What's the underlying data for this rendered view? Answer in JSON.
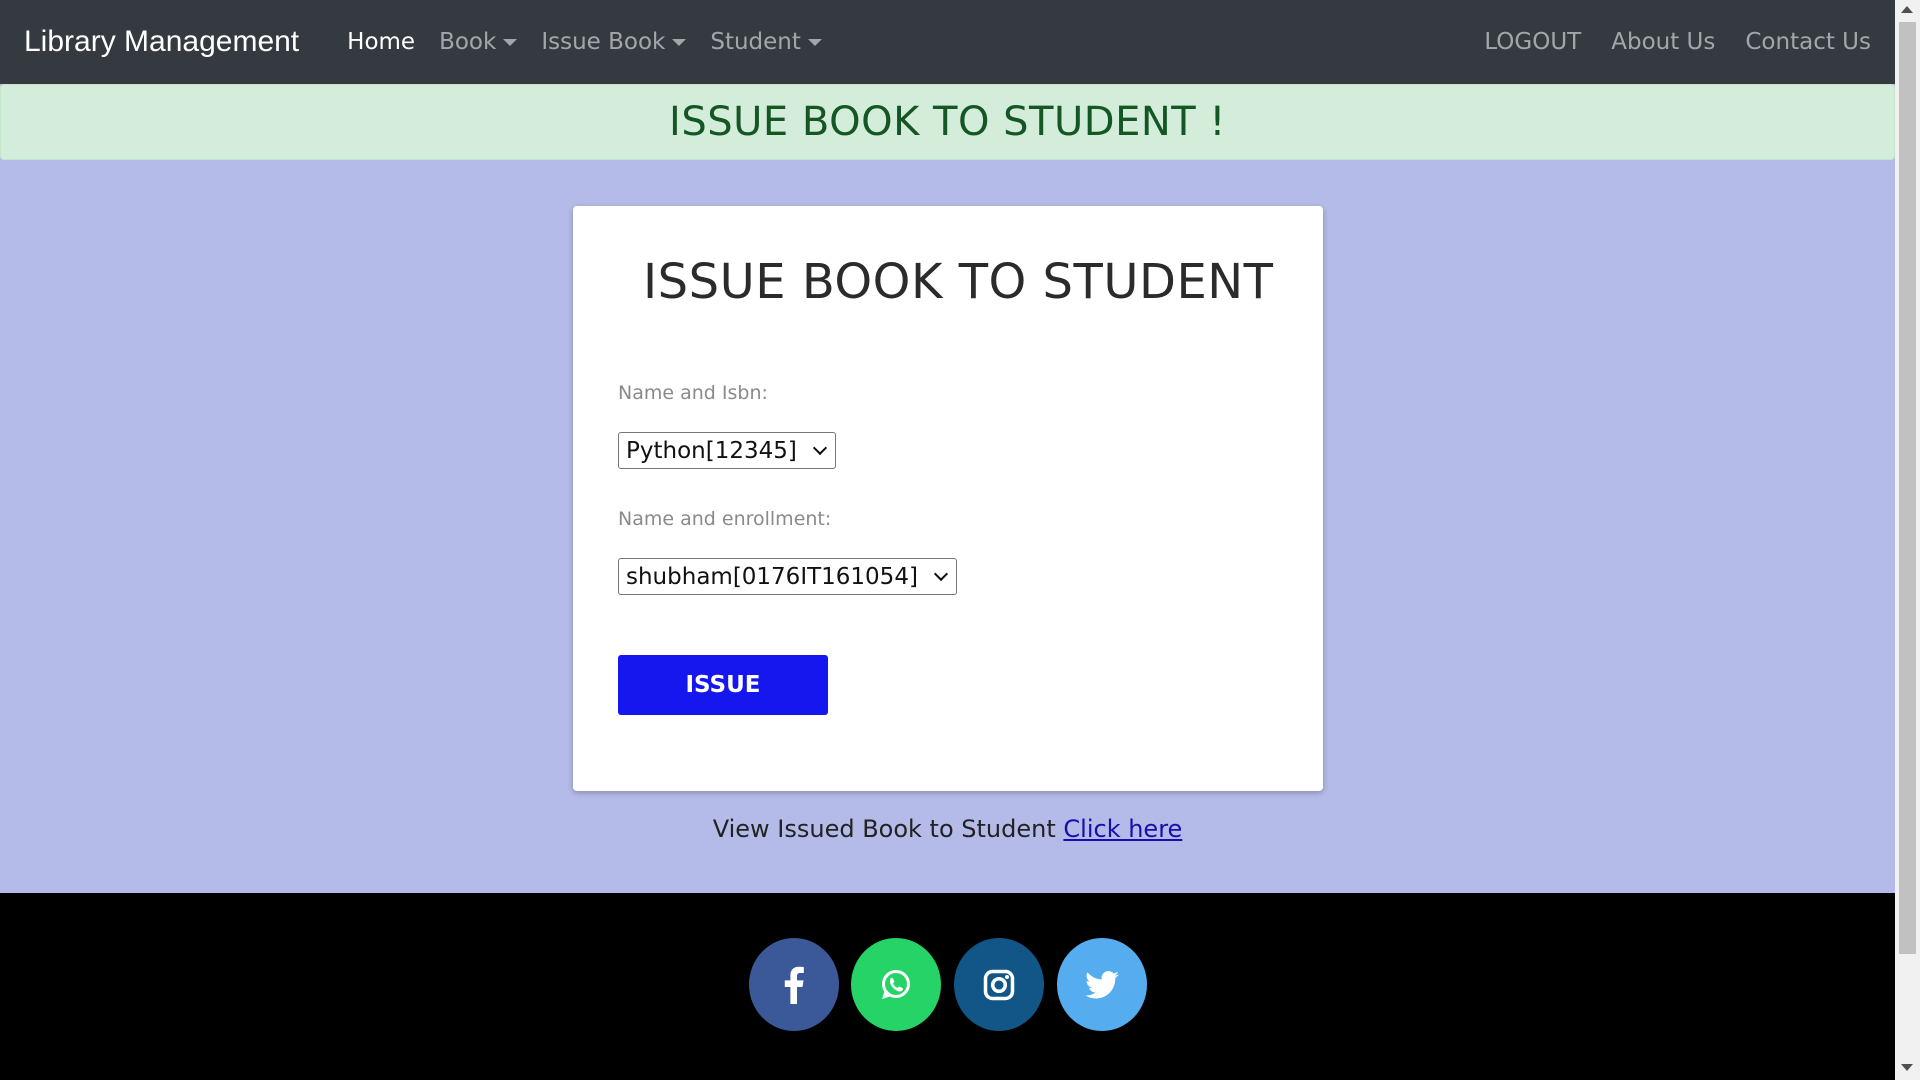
{
  "navbar": {
    "brand": "Library Management",
    "left_items": [
      {
        "label": "Home",
        "active": true,
        "dropdown": false
      },
      {
        "label": "Book",
        "active": false,
        "dropdown": true
      },
      {
        "label": "Issue Book",
        "active": false,
        "dropdown": true
      },
      {
        "label": "Student",
        "active": false,
        "dropdown": true
      }
    ],
    "right_items": [
      {
        "label": "LOGOUT"
      },
      {
        "label": "About Us"
      },
      {
        "label": "Contact Us"
      }
    ]
  },
  "alert": {
    "text": "ISSUE BOOK TO STUDENT !",
    "color": "#155724",
    "background": "#d4edda"
  },
  "form": {
    "title": "ISSUE BOOK TO STUDENT",
    "book_label": "Name and Isbn:",
    "book_selected": "Python[12345]",
    "student_label": "Name and enrollment:",
    "student_selected": "shubham[0176IT161054]",
    "submit_label": "ISSUE",
    "submit_color": "#1616ef"
  },
  "view_issued": {
    "text": "View Issued Book to Student",
    "link_text": "Click here"
  },
  "footer": {
    "social": [
      {
        "icon": "facebook-icon",
        "color": "#3b5998"
      },
      {
        "icon": "whatsapp-icon",
        "color": "#25d366"
      },
      {
        "icon": "instagram-icon",
        "color": "#125688"
      },
      {
        "icon": "twitter-icon",
        "color": "#55acee"
      }
    ]
  },
  "page_background": "#b4bbe8"
}
